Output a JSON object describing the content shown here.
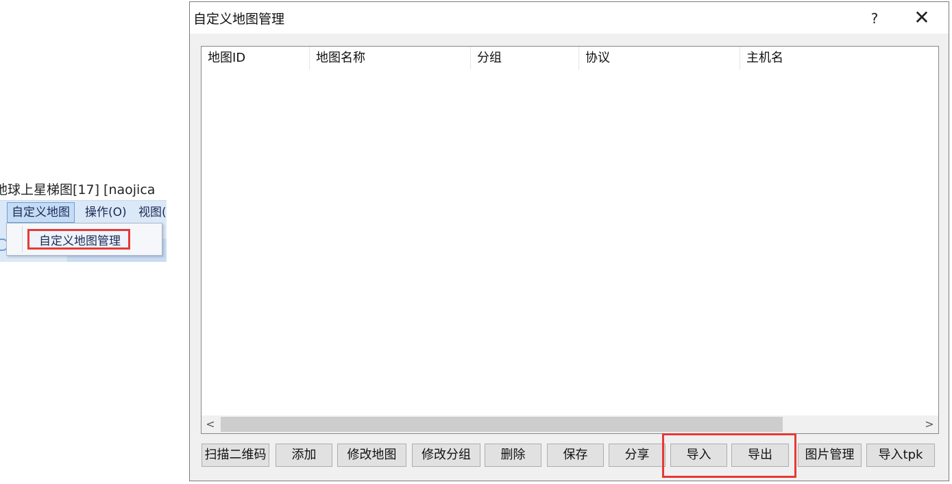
{
  "snippet": {
    "title": "地球上星梯图[17] [naojica",
    "menu": {
      "items": [
        "自定义地图",
        "操作(O)",
        "视图("
      ],
      "dropdown_item": "自定义地图管理"
    }
  },
  "dialog": {
    "title": "自定义地图管理",
    "help_label": "?",
    "close_label": "✕",
    "columns": [
      "地图ID",
      "地图名称",
      "分组",
      "协议",
      "主机名"
    ],
    "scroll_left": "<",
    "scroll_right": ">",
    "buttons": [
      "扫描二维码",
      "添加",
      "修改地图",
      "修改分组",
      "删除",
      "保存",
      "分享",
      "导入",
      "导出",
      "图片管理",
      "导入tpk"
    ]
  },
  "colors": {
    "highlight": "#e53935",
    "menubar": "#dbe8f7"
  },
  "icons": [
    "help-icon",
    "close-icon",
    "chevron-left-icon",
    "chevron-right-icon"
  ]
}
